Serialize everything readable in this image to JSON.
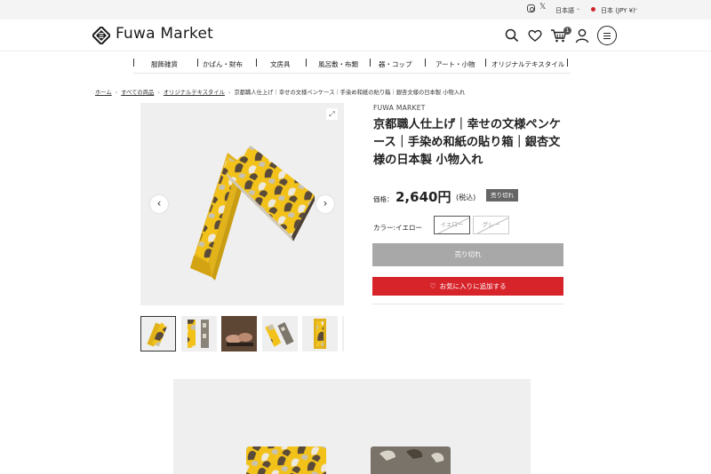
{
  "topbar": {
    "icons": [
      "instagram-icon",
      "x-icon"
    ],
    "x_glyph": "𝕏",
    "language": "日本語",
    "currency": "日本 (JPY ¥)",
    "caret": "⌄"
  },
  "header": {
    "logo_text": "Fuwa Market",
    "icons": [
      "search-icon",
      "heart-icon",
      "cart-icon",
      "user-icon",
      "menu-icon"
    ],
    "cart_count": "1"
  },
  "category_nav": [
    {
      "label": "服飾雑貨"
    },
    {
      "label": "かばん・財布"
    },
    {
      "label": "文房具"
    },
    {
      "label": "風呂敷・布類"
    },
    {
      "label": "器・コップ"
    },
    {
      "label": "アート・小物"
    },
    {
      "label": "オリジナルテキスタイル"
    }
  ],
  "breadcrumb": {
    "items": [
      "ホーム",
      "すべての商品",
      "オリジナルテキスタイル"
    ],
    "current": "京都職人仕上げ｜幸せの文様ペンケース｜手染め和紙の貼り箱｜銀杏文様の日本製 小物入れ",
    "separator": "›"
  },
  "gallery": {
    "prev_glyph": "‹",
    "next_glyph": "›",
    "zoom_glyph": "⤢",
    "thumbnail_count": 6,
    "selected_thumbnail": 1
  },
  "product": {
    "brand": "FUWA MARKET",
    "title": "京都職人仕上げ｜幸せの文様ペンケース｜手染め和紙の貼り箱｜銀杏文様の日本製 小物入れ",
    "price_label": "価格：",
    "price": "2,640円",
    "tax_note": "(税込)",
    "sold_out_badge": "売り切れ",
    "color_label": "カラー:イエロー",
    "color_options": [
      "イエロー",
      "グレー"
    ],
    "selected_color": "イエロー",
    "sold_out_button": "売り切れ",
    "favorite_button": "お気に入りに追加する"
  },
  "colors": {
    "accent_red": "#d7232a",
    "yellow": "#f2c21b",
    "sold_out_gray": "#a8a8a8",
    "badge_gray": "#666666"
  }
}
